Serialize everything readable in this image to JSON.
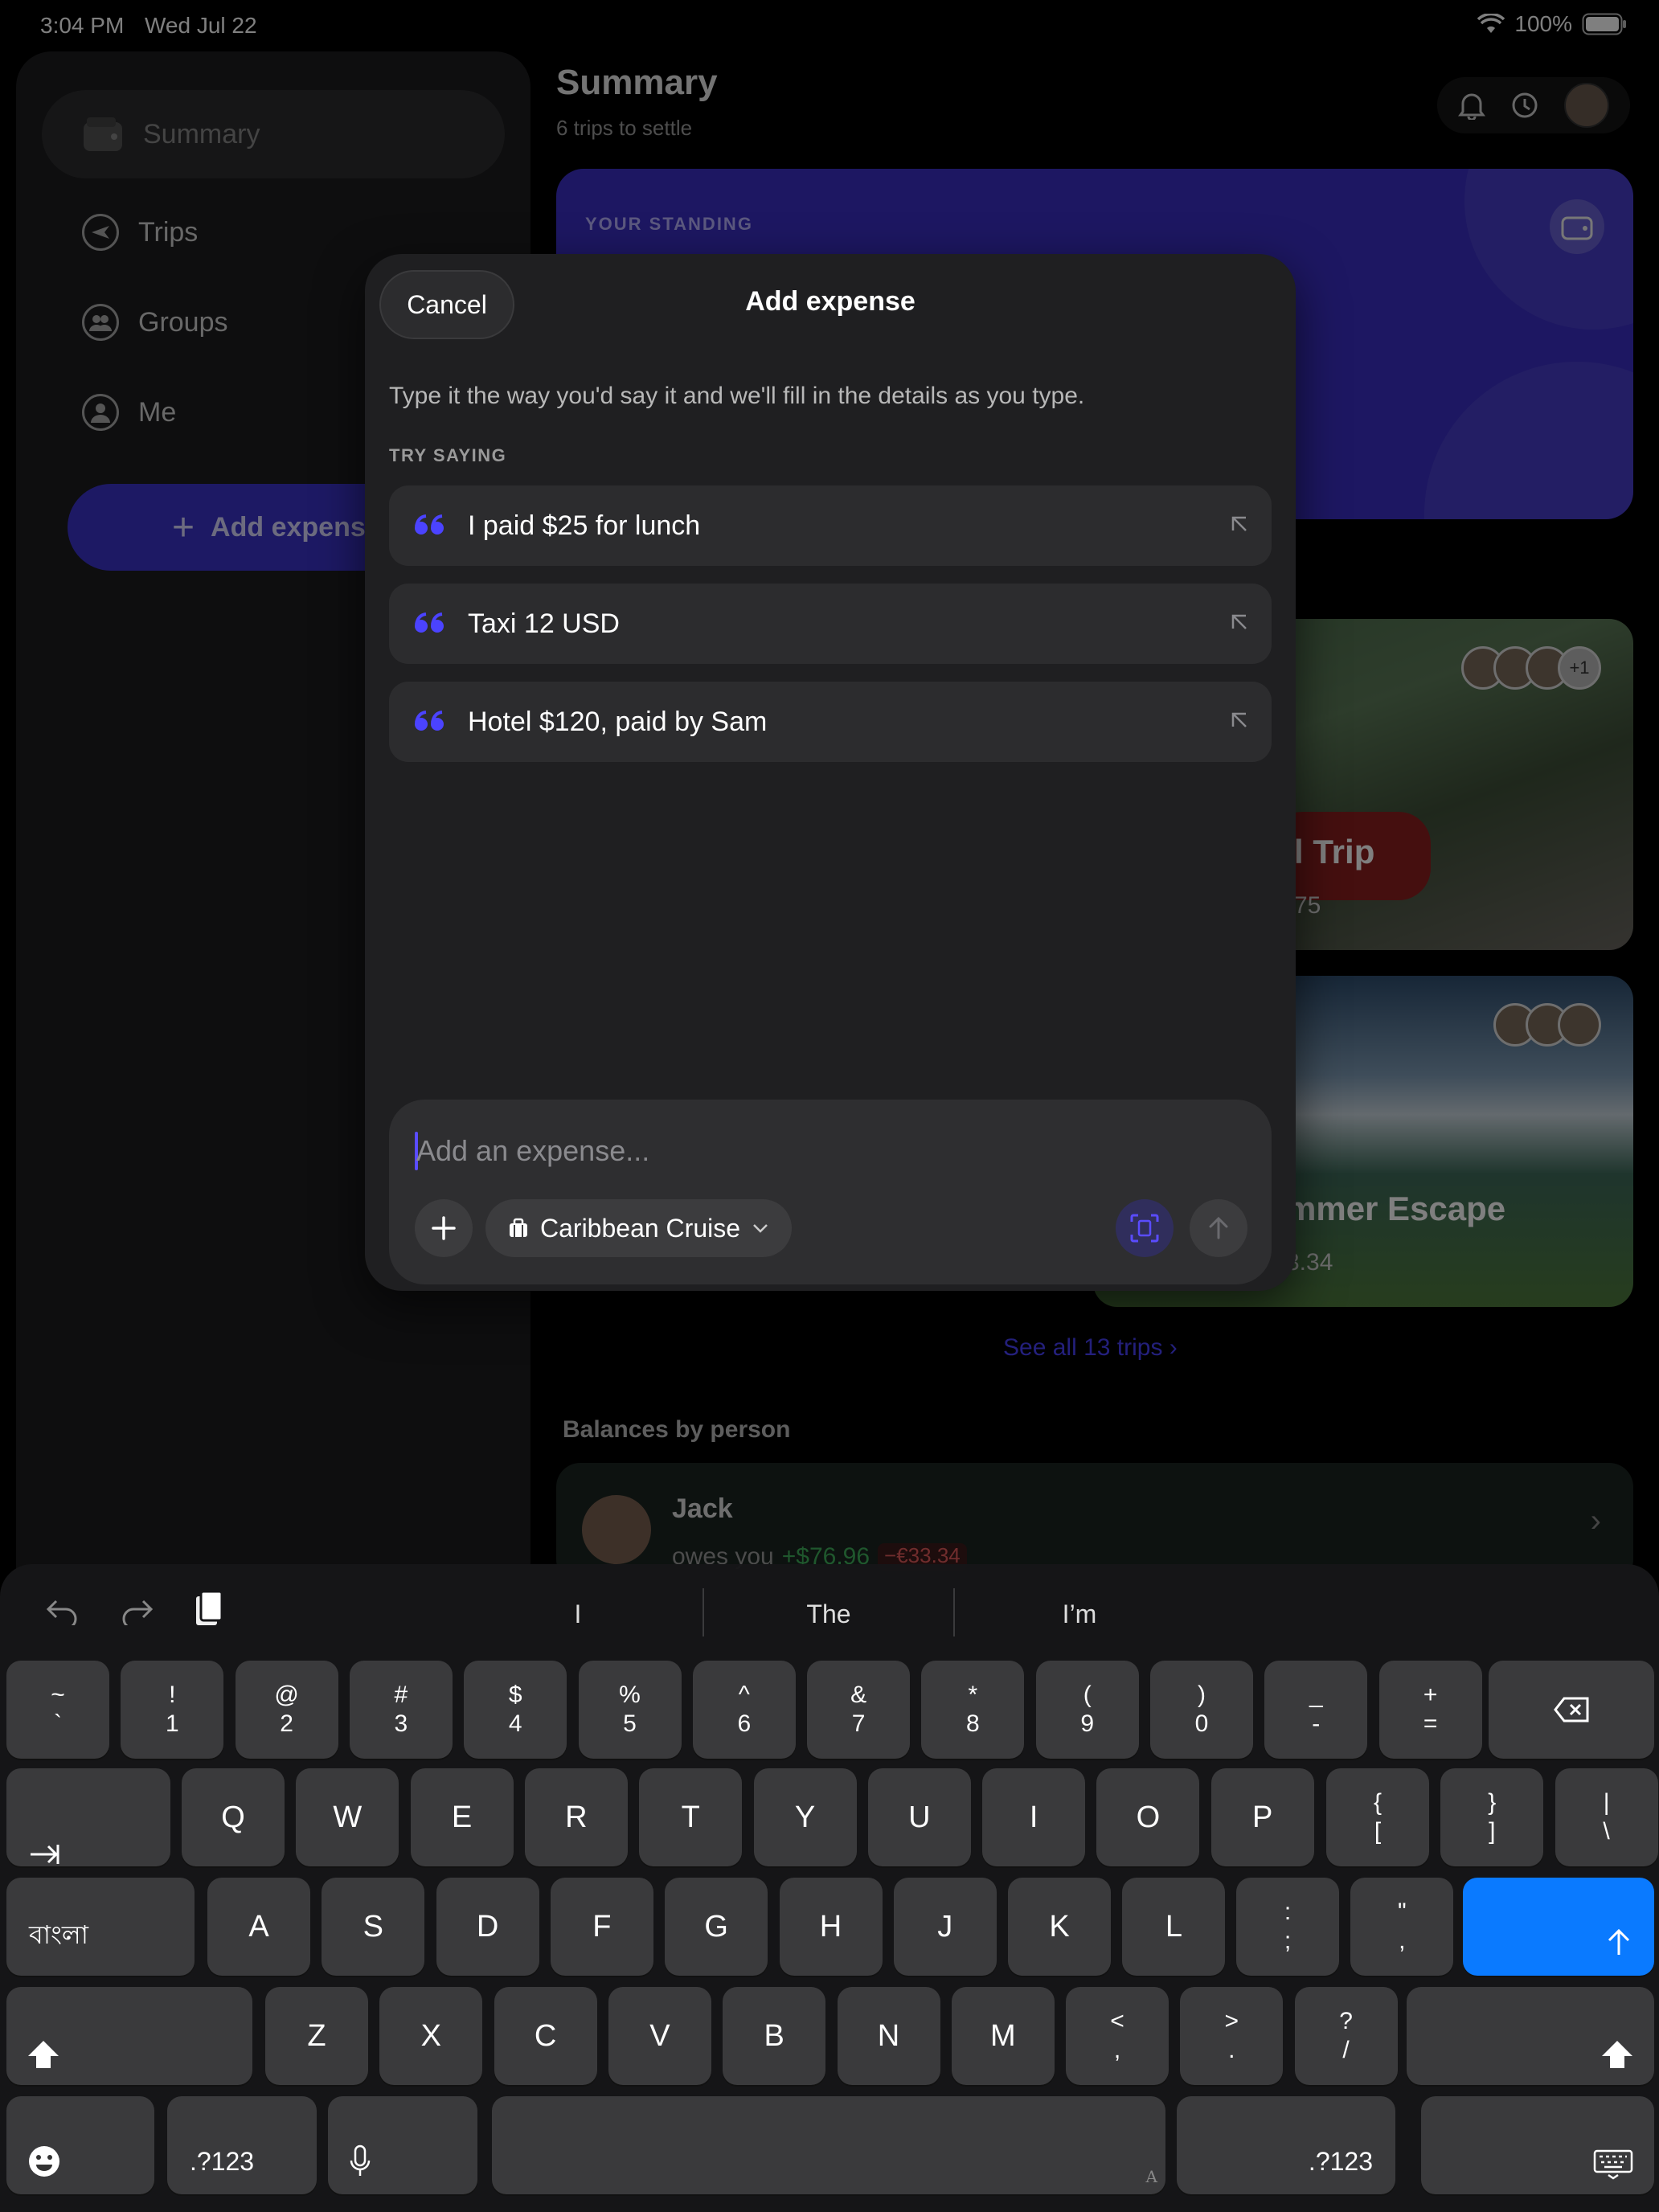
{
  "status_bar": {
    "time": "3:04 PM",
    "date": "Wed Jul 22",
    "battery": "100%"
  },
  "sidebar": {
    "items": [
      {
        "label": "Summary",
        "icon": "wallet-icon"
      },
      {
        "label": "Trips",
        "icon": "airplane-icon"
      },
      {
        "label": "Groups",
        "icon": "people-icon"
      },
      {
        "label": "Me",
        "icon": "person-icon"
      }
    ],
    "add_button": "Add expens"
  },
  "main": {
    "title": "Summary",
    "subtitle": "6 trips to settle",
    "standing_label": "YOUR STANDING",
    "trips": [
      {
        "name": "l Trip",
        "amount": "75",
        "extra_members": "+1"
      },
      {
        "name": "mmer Escape",
        "amount": "3.34"
      }
    ],
    "see_all": "See all 13 trips",
    "balances_title": "Balances by person",
    "person": {
      "name": "Jack",
      "text": "owes you",
      "positive": "+$76.96",
      "negative": "−€33.34"
    }
  },
  "modal": {
    "cancel": "Cancel",
    "title": "Add expense",
    "description": "Type it the way you'd say it and we'll fill in the details as you type.",
    "try_label": "TRY SAYING",
    "suggestions": [
      "I paid $25 for lunch",
      "Taxi 12 USD",
      "Hotel $120, paid by Sam"
    ],
    "input_placeholder": "Add an expense...",
    "trip_selector": "Caribbean Cruise"
  },
  "keyboard": {
    "predictions": [
      "I",
      "The",
      "I’m"
    ],
    "row1": [
      [
        "~",
        "`"
      ],
      [
        "!",
        "1"
      ],
      [
        "@",
        "2"
      ],
      [
        "#",
        "3"
      ],
      [
        "$",
        "4"
      ],
      [
        "%",
        "5"
      ],
      [
        "^",
        "6"
      ],
      [
        "&",
        "7"
      ],
      [
        "*",
        "8"
      ],
      [
        "(",
        "9"
      ],
      [
        ")",
        "0"
      ],
      [
        "_",
        "-"
      ],
      [
        "+",
        "="
      ]
    ],
    "row2": [
      "Q",
      "W",
      "E",
      "R",
      "T",
      "Y",
      "U",
      "I",
      "O",
      "P"
    ],
    "row2_extra": [
      [
        "{",
        "["
      ],
      [
        "}",
        "]"
      ],
      [
        "|",
        "\\"
      ]
    ],
    "row3": [
      "A",
      "S",
      "D",
      "F",
      "G",
      "H",
      "J",
      "K",
      "L"
    ],
    "row3_extra": [
      [
        ":",
        ";"
      ],
      [
        "\"",
        ","
      ]
    ],
    "row4": [
      "Z",
      "X",
      "C",
      "V",
      "B",
      "N",
      "M"
    ],
    "row4_extra": [
      [
        "<",
        ","
      ],
      [
        ">",
        "."
      ],
      [
        "?",
        "/"
      ]
    ],
    "lang_key": "বাংলা",
    "numeric_key": ".?123",
    "space_hint": "A",
    "accent_color": "#0a7aff"
  }
}
